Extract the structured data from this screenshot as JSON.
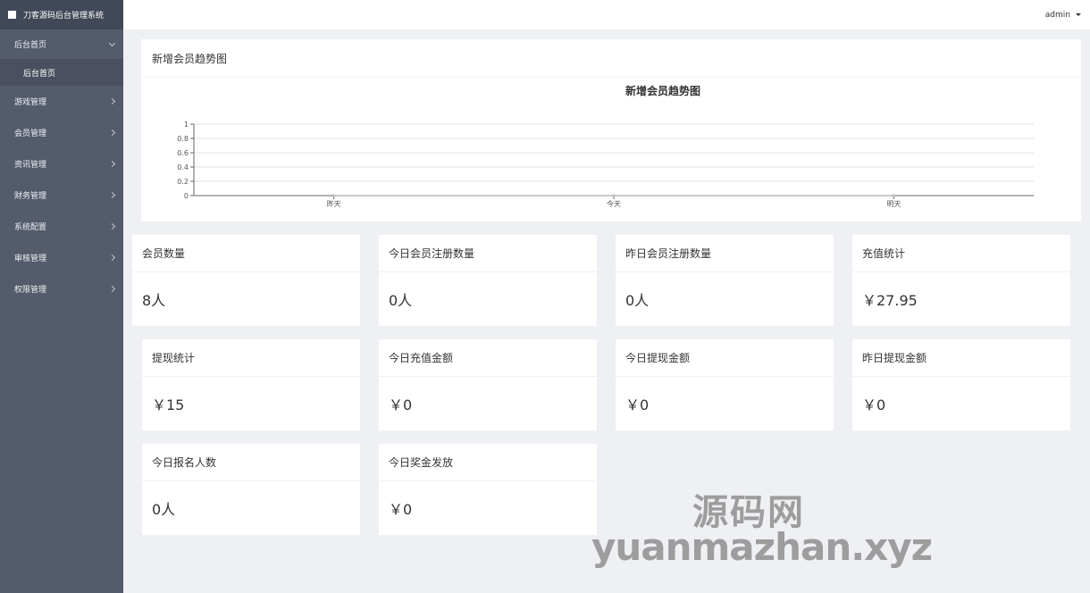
{
  "app": {
    "title": "刀客源码后台管理系统"
  },
  "sidebar": {
    "items": [
      {
        "label": "后台首页",
        "expanded": true,
        "children": [
          {
            "label": "后台首页"
          }
        ]
      },
      {
        "label": "游戏管理"
      },
      {
        "label": "会员管理"
      },
      {
        "label": "资讯管理"
      },
      {
        "label": "财务管理"
      },
      {
        "label": "系统配置"
      },
      {
        "label": "审核管理"
      },
      {
        "label": "权限管理"
      }
    ]
  },
  "topbar": {
    "user": "admin"
  },
  "panel": {
    "title": "新增会员趋势图"
  },
  "chart_data": {
    "type": "line",
    "title": "新增会员趋势图",
    "categories": [
      "昨天",
      "今天",
      "明天"
    ],
    "series": [
      {
        "values": [
          0,
          0,
          0
        ]
      }
    ],
    "ylim": [
      0,
      1
    ],
    "yticks": [
      "1",
      "0.8",
      "0.6",
      "0.4",
      "0.2",
      "0"
    ],
    "grid": true
  },
  "stats": [
    {
      "title": "会员数量",
      "value": "8人"
    },
    {
      "title": "今日会员注册数量",
      "value": "0人"
    },
    {
      "title": "昨日会员注册数量",
      "value": "0人"
    },
    {
      "title": "充值统计",
      "value": "￥27.95"
    },
    {
      "title": "提现统计",
      "value": "￥15"
    },
    {
      "title": "今日充值金额",
      "value": "￥0"
    },
    {
      "title": "今日提现金额",
      "value": "￥0"
    },
    {
      "title": "昨日提现金额",
      "value": "￥0"
    },
    {
      "title": "今日报名人数",
      "value": "0人"
    },
    {
      "title": "今日奖金发放",
      "value": "￥0"
    }
  ],
  "watermark": {
    "line1": "源码网",
    "line2": "yuanmazhan.xyz"
  },
  "colors": {
    "sidebar": "#545b6b",
    "brand_bar": "#414857",
    "background": "#eef0f4"
  }
}
